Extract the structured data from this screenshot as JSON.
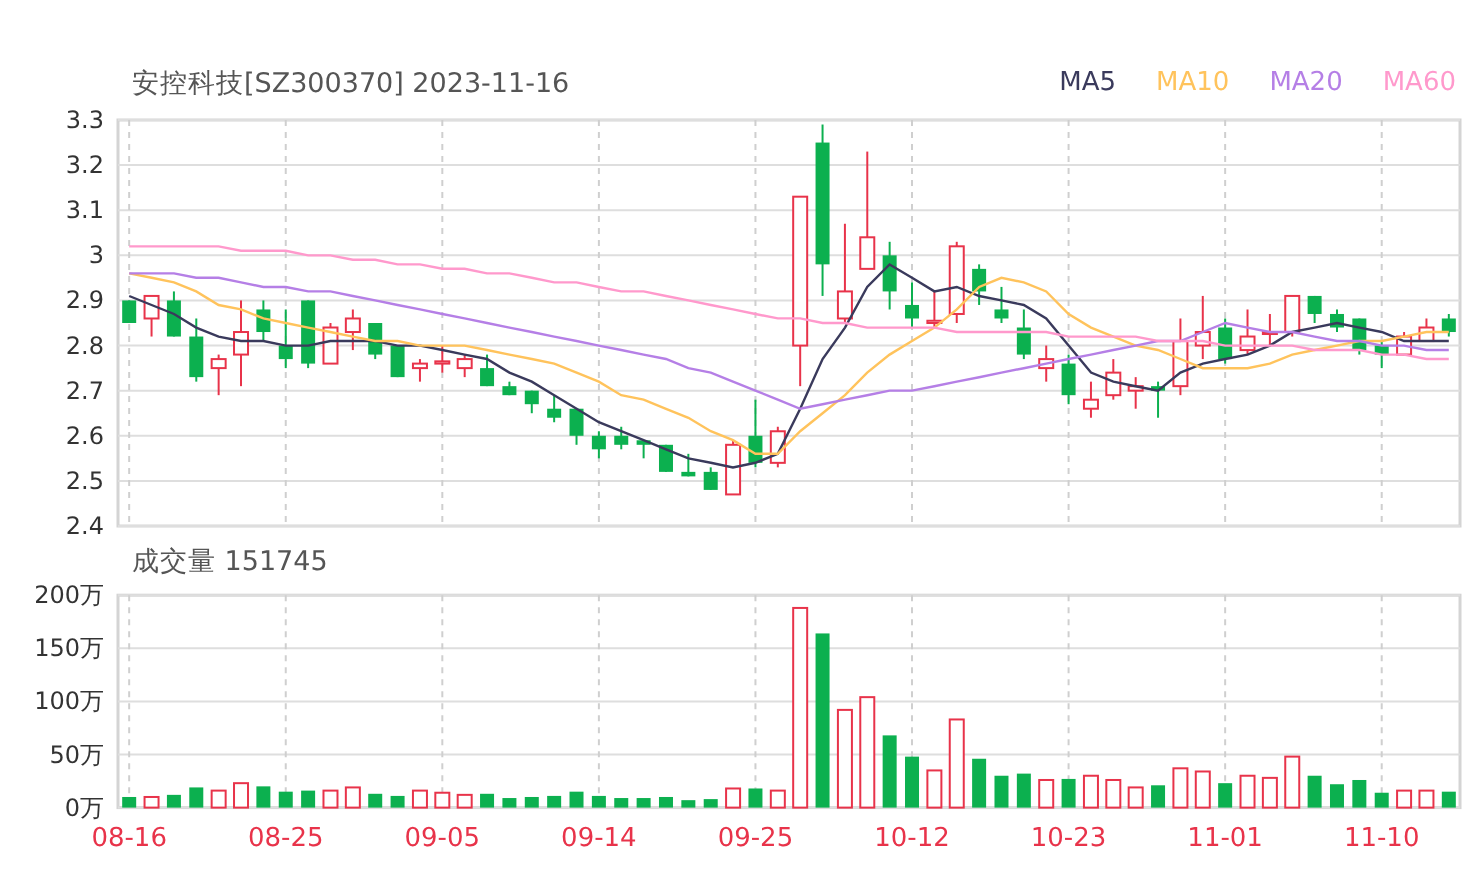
{
  "header": {
    "title": "安控科技[SZ300370] 2023-11-16"
  },
  "price_chart": {
    "chart_data": {
      "type": "candlestick",
      "grid": true,
      "ylim": [
        2.4,
        3.3
      ],
      "yticks": [
        2.4,
        2.5,
        2.6,
        2.7,
        2.8,
        2.9,
        3,
        3.1,
        3.2,
        3.3
      ],
      "categories": [
        null,
        null,
        null,
        null,
        null,
        null,
        null,
        null,
        null,
        null,
        null,
        null,
        null,
        null,
        null,
        null,
        null,
        null,
        null,
        null,
        null,
        null,
        null,
        null,
        null,
        null,
        null,
        null,
        null,
        null,
        null,
        null,
        null,
        null,
        null,
        null,
        null,
        null,
        null,
        null,
        null,
        null,
        null,
        null,
        null,
        null,
        null,
        null,
        null,
        null,
        null,
        null,
        null,
        null,
        null,
        null,
        null,
        null,
        null,
        null
      ],
      "ohlc": [
        [
          2.9,
          2.9,
          2.85,
          2.85
        ],
        [
          2.86,
          2.91,
          2.82,
          2.91
        ],
        [
          2.9,
          2.92,
          2.82,
          2.82
        ],
        [
          2.82,
          2.86,
          2.72,
          2.73
        ],
        [
          2.75,
          2.78,
          2.69,
          2.77
        ],
        [
          2.78,
          2.9,
          2.71,
          2.83
        ],
        [
          2.88,
          2.9,
          2.81,
          2.83
        ],
        [
          2.8,
          2.88,
          2.75,
          2.77
        ],
        [
          2.9,
          2.9,
          2.75,
          2.76
        ],
        [
          2.76,
          2.85,
          2.76,
          2.84
        ],
        [
          2.83,
          2.88,
          2.79,
          2.86
        ],
        [
          2.85,
          2.85,
          2.77,
          2.78
        ],
        [
          2.8,
          2.8,
          2.73,
          2.73
        ],
        [
          2.75,
          2.77,
          2.72,
          2.76
        ],
        [
          2.76,
          2.8,
          2.74,
          2.765
        ],
        [
          2.75,
          2.78,
          2.73,
          2.77
        ],
        [
          2.75,
          2.78,
          2.71,
          2.71
        ],
        [
          2.71,
          2.72,
          2.69,
          2.69
        ],
        [
          2.7,
          2.7,
          2.65,
          2.67
        ],
        [
          2.66,
          2.69,
          2.63,
          2.64
        ],
        [
          2.66,
          2.66,
          2.58,
          2.6
        ],
        [
          2.6,
          2.61,
          2.55,
          2.57
        ],
        [
          2.6,
          2.62,
          2.57,
          2.58
        ],
        [
          2.59,
          2.59,
          2.55,
          2.58
        ],
        [
          2.58,
          2.58,
          2.52,
          2.52
        ],
        [
          2.52,
          2.56,
          2.51,
          2.51
        ],
        [
          2.52,
          2.53,
          2.48,
          2.48
        ],
        [
          2.47,
          2.59,
          2.47,
          2.58
        ],
        [
          2.6,
          2.68,
          2.53,
          2.54
        ],
        [
          2.54,
          2.62,
          2.53,
          2.61
        ],
        [
          2.8,
          3.13,
          2.71,
          3.13
        ],
        [
          3.25,
          3.29,
          2.91,
          2.98
        ],
        [
          2.86,
          3.07,
          2.85,
          2.92
        ],
        [
          2.97,
          3.23,
          2.97,
          3.04
        ],
        [
          3.0,
          3.03,
          2.88,
          2.92
        ],
        [
          2.89,
          2.94,
          2.84,
          2.86
        ],
        [
          2.85,
          2.92,
          2.84,
          2.855
        ],
        [
          2.87,
          3.03,
          2.85,
          3.02
        ],
        [
          2.97,
          2.98,
          2.89,
          2.92
        ],
        [
          2.88,
          2.93,
          2.85,
          2.86
        ],
        [
          2.84,
          2.88,
          2.77,
          2.78
        ],
        [
          2.75,
          2.8,
          2.72,
          2.77
        ],
        [
          2.76,
          2.78,
          2.67,
          2.69
        ],
        [
          2.66,
          2.72,
          2.64,
          2.68
        ],
        [
          2.69,
          2.77,
          2.68,
          2.74
        ],
        [
          2.7,
          2.73,
          2.66,
          2.71
        ],
        [
          2.71,
          2.72,
          2.64,
          2.7
        ],
        [
          2.71,
          2.86,
          2.69,
          2.81
        ],
        [
          2.8,
          2.91,
          2.77,
          2.83
        ],
        [
          2.84,
          2.86,
          2.76,
          2.77
        ],
        [
          2.79,
          2.88,
          2.78,
          2.82
        ],
        [
          2.826,
          2.87,
          2.8,
          2.83
        ],
        [
          2.83,
          2.91,
          2.82,
          2.91
        ],
        [
          2.91,
          2.91,
          2.85,
          2.87
        ],
        [
          2.87,
          2.88,
          2.83,
          2.84
        ],
        [
          2.86,
          2.86,
          2.78,
          2.79
        ],
        [
          2.8,
          2.81,
          2.75,
          2.78
        ],
        [
          2.78,
          2.83,
          2.78,
          2.82
        ],
        [
          2.81,
          2.86,
          2.81,
          2.84
        ],
        [
          2.86,
          2.87,
          2.82,
          2.83
        ]
      ],
      "series": [
        {
          "name": "MA5",
          "type": "line",
          "color": "#3a3a5c",
          "values": [
            2.91,
            2.89,
            2.87,
            2.84,
            2.82,
            2.81,
            2.81,
            2.8,
            2.8,
            2.81,
            2.81,
            2.81,
            2.8,
            2.8,
            2.79,
            2.78,
            2.77,
            2.74,
            2.72,
            2.69,
            2.66,
            2.63,
            2.61,
            2.59,
            2.57,
            2.55,
            2.54,
            2.53,
            2.54,
            2.56,
            2.66,
            2.77,
            2.84,
            2.93,
            2.98,
            2.95,
            2.92,
            2.93,
            2.91,
            2.9,
            2.89,
            2.86,
            2.8,
            2.74,
            2.72,
            2.71,
            2.7,
            2.74,
            2.76,
            2.77,
            2.78,
            2.8,
            2.83,
            2.84,
            2.85,
            2.84,
            2.83,
            2.81,
            2.81,
            2.81
          ]
        },
        {
          "name": "MA10",
          "type": "line",
          "color": "#ffc35c",
          "values": [
            2.96,
            2.95,
            2.94,
            2.92,
            2.89,
            2.88,
            2.86,
            2.85,
            2.84,
            2.83,
            2.82,
            2.81,
            2.81,
            2.8,
            2.8,
            2.8,
            2.79,
            2.78,
            2.77,
            2.76,
            2.74,
            2.72,
            2.69,
            2.68,
            2.66,
            2.64,
            2.61,
            2.59,
            2.56,
            2.56,
            2.61,
            2.65,
            2.69,
            2.74,
            2.78,
            2.81,
            2.84,
            2.88,
            2.93,
            2.95,
            2.94,
            2.92,
            2.87,
            2.84,
            2.82,
            2.8,
            2.79,
            2.77,
            2.75,
            2.75,
            2.75,
            2.76,
            2.78,
            2.79,
            2.8,
            2.81,
            2.81,
            2.82,
            2.83,
            2.83
          ]
        },
        {
          "name": "MA20",
          "type": "line",
          "color": "#b57fe6",
          "values": [
            2.96,
            2.96,
            2.96,
            2.95,
            2.95,
            2.94,
            2.93,
            2.93,
            2.92,
            2.92,
            2.91,
            2.9,
            2.89,
            2.88,
            2.87,
            2.86,
            2.85,
            2.84,
            2.83,
            2.82,
            2.81,
            2.8,
            2.79,
            2.78,
            2.77,
            2.75,
            2.74,
            2.72,
            2.7,
            2.68,
            2.66,
            2.67,
            2.68,
            2.69,
            2.7,
            2.7,
            2.71,
            2.72,
            2.73,
            2.74,
            2.75,
            2.76,
            2.77,
            2.78,
            2.79,
            2.8,
            2.81,
            2.81,
            2.83,
            2.85,
            2.84,
            2.83,
            2.83,
            2.82,
            2.81,
            2.81,
            2.8,
            2.8,
            2.79,
            2.79
          ]
        },
        {
          "name": "MA60",
          "type": "line",
          "color": "#ff99cc",
          "values": [
            3.02,
            3.02,
            3.02,
            3.02,
            3.02,
            3.01,
            3.01,
            3.01,
            3.0,
            3.0,
            2.99,
            2.99,
            2.98,
            2.98,
            2.97,
            2.97,
            2.96,
            2.96,
            2.95,
            2.94,
            2.94,
            2.93,
            2.92,
            2.92,
            2.91,
            2.9,
            2.89,
            2.88,
            2.87,
            2.86,
            2.86,
            2.85,
            2.85,
            2.84,
            2.84,
            2.84,
            2.84,
            2.83,
            2.83,
            2.83,
            2.83,
            2.83,
            2.82,
            2.82,
            2.82,
            2.82,
            2.81,
            2.81,
            2.81,
            2.8,
            2.8,
            2.8,
            2.8,
            2.79,
            2.79,
            2.79,
            2.78,
            2.78,
            2.77,
            2.77
          ]
        }
      ]
    }
  },
  "volume_chart": {
    "chart_data": {
      "type": "bar",
      "title": "成交量 151745",
      "grid": true,
      "ylim": [
        0,
        200
      ],
      "yticks": [
        {
          "value": 0,
          "label": "0万"
        },
        {
          "value": 50,
          "label": "50万"
        },
        {
          "value": 100,
          "label": "100万"
        },
        {
          "value": 150,
          "label": "150万"
        },
        {
          "value": 200,
          "label": "200万"
        }
      ],
      "categories": [
        "08-16",
        null,
        null,
        null,
        null,
        null,
        null,
        "08-25",
        null,
        null,
        null,
        null,
        null,
        null,
        "09-05",
        null,
        null,
        null,
        null,
        null,
        null,
        "09-14",
        null,
        null,
        null,
        null,
        null,
        null,
        "09-25",
        null,
        null,
        null,
        null,
        null,
        null,
        "10-12",
        null,
        null,
        null,
        null,
        null,
        null,
        "10-23",
        null,
        null,
        null,
        null,
        null,
        null,
        "11-01",
        null,
        null,
        null,
        null,
        null,
        null,
        "11-10",
        null,
        null,
        null
      ],
      "values": [
        10,
        10,
        12,
        19,
        16,
        23,
        20,
        15,
        16,
        16,
        19,
        13,
        11,
        16,
        14,
        12,
        13,
        9,
        10,
        11,
        15,
        11,
        9,
        9,
        10,
        7,
        8,
        18,
        18,
        16,
        188,
        164,
        92,
        104,
        68,
        48,
        35,
        83,
        46,
        30,
        32,
        26,
        27,
        30,
        26,
        19,
        21,
        37,
        34,
        23,
        30,
        28,
        48,
        30,
        22,
        26,
        14,
        16,
        16,
        15
      ]
    }
  }
}
